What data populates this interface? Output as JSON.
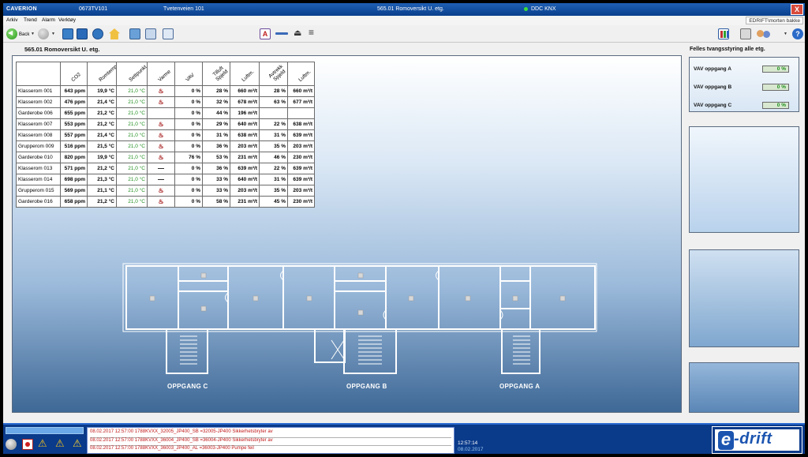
{
  "titlebar": {
    "brand": "CAVERION",
    "project": "0673TV101",
    "address": "Tvetenveien 101",
    "view_title": "565.01 Romoversikt U. etg.",
    "connection": "DDC KNX",
    "close": "X"
  },
  "menu": [
    "Arkiv",
    "Trend",
    "Alarm",
    "Verktøy"
  ],
  "user": "EDRIFT\\morten bakke",
  "toolbar": {
    "back_label": "Back",
    "help_label": "?"
  },
  "main": {
    "title": "565.01 Romoversikt U. etg.",
    "table": {
      "headers": [
        "",
        "CO2",
        "Romtemp",
        "Settpunkt",
        "Varme",
        "VAV",
        "Tilluft Spjeld",
        "Luftm.",
        "Avtrekk Spjeld",
        "Luftm."
      ],
      "rows": [
        {
          "room": "Klasserom 001",
          "co2": "643 ppm",
          "temp": "19,9 °C",
          "set": "21,0 °C",
          "heat": true,
          "vav": "0 %",
          "sup_damper": "28 %",
          "sup_flow": "660 m³/t",
          "ext_damper": "28 %",
          "ext_flow": "660 m³/t"
        },
        {
          "room": "Klasserom 002",
          "co2": "476 ppm",
          "temp": "21,4 °C",
          "set": "21,0 °C",
          "heat": true,
          "vav": "0 %",
          "sup_damper": "32 %",
          "sup_flow": "678 m³/t",
          "ext_damper": "63 %",
          "ext_flow": "677 m³/t"
        },
        {
          "room": "Garderobe 006",
          "co2": "655 ppm",
          "temp": "21,2 °C",
          "set": "21,0 °C",
          "heat": null,
          "vav": "0 %",
          "sup_damper": "44 %",
          "sup_flow": "196 m³/t",
          "ext_damper": "",
          "ext_flow": ""
        },
        {
          "room": "Klasserom 007",
          "co2": "553 ppm",
          "temp": "21,2 °C",
          "set": "21,0 °C",
          "heat": true,
          "vav": "0 %",
          "sup_damper": "29 %",
          "sup_flow": "640 m³/t",
          "ext_damper": "22 %",
          "ext_flow": "638 m³/t"
        },
        {
          "room": "Klasserom 008",
          "co2": "557 ppm",
          "temp": "21,4 °C",
          "set": "21,0 °C",
          "heat": true,
          "vav": "0 %",
          "sup_damper": "31 %",
          "sup_flow": "638 m³/t",
          "ext_damper": "31 %",
          "ext_flow": "639 m³/t"
        },
        {
          "room": "Grupperom 009",
          "co2": "516 ppm",
          "temp": "21,5 °C",
          "set": "21,0 °C",
          "heat": true,
          "vav": "0 %",
          "sup_damper": "36 %",
          "sup_flow": "203 m³/t",
          "ext_damper": "35 %",
          "ext_flow": "203 m³/t"
        },
        {
          "room": "Garderobe 010",
          "co2": "820 ppm",
          "temp": "19,9 °C",
          "set": "21,0 °C",
          "heat": true,
          "vav": "76 %",
          "sup_damper": "53 %",
          "sup_flow": "231 m³/t",
          "ext_damper": "46 %",
          "ext_flow": "230 m³/t"
        },
        {
          "room": "Klasserom 013",
          "co2": "571 ppm",
          "temp": "21,2 °C",
          "set": "21,0 °C",
          "heat": false,
          "vav": "0 %",
          "sup_damper": "36 %",
          "sup_flow": "639 m³/t",
          "ext_damper": "22 %",
          "ext_flow": "639 m³/t"
        },
        {
          "room": "Klasserom 014",
          "co2": "698 ppm",
          "temp": "21,3 °C",
          "set": "21,0 °C",
          "heat": false,
          "vav": "0 %",
          "sup_damper": "33 %",
          "sup_flow": "640 m³/t",
          "ext_damper": "31 %",
          "ext_flow": "639 m³/t"
        },
        {
          "room": "Grupperom 015",
          "co2": "569 ppm",
          "temp": "21,1 °C",
          "set": "21,0 °C",
          "heat": true,
          "vav": "0 %",
          "sup_damper": "33 %",
          "sup_flow": "203 m³/t",
          "ext_damper": "35 %",
          "ext_flow": "203 m³/t"
        },
        {
          "room": "Garderobe 016",
          "co2": "658 ppm",
          "temp": "21,2 °C",
          "set": "21,0 °C",
          "heat": true,
          "vav": "0 %",
          "sup_damper": "58 %",
          "sup_flow": "231 m³/t",
          "ext_damper": "45 %",
          "ext_flow": "230 m³/t"
        }
      ]
    },
    "floorplan": {
      "labels": [
        "OPPGANG C",
        "OPPGANG B",
        "OPPGANG A"
      ]
    }
  },
  "right": {
    "header": "Felles tvangsstyring alle etg.",
    "vav": [
      {
        "label": "VAV oppgang A",
        "value": "0 %"
      },
      {
        "label": "VAV oppgang B",
        "value": "0 %"
      },
      {
        "label": "VAV oppgang C",
        "value": "0 %"
      }
    ]
  },
  "status": {
    "alarms": [
      "08.02.2017 12:57:00   1788KVXX_32005_JP400_SB =32005-JP400 Sikkerhetsbryter av",
      "08.02.2017 12:57:00   1788KVXX_36004_JP400_SB =36004-JP400 Sikkerhetsbryter av",
      "08.02.2017 12:57:00   1788KVXX_36003_JP400_AL =36003-JP400 Pumpe feil"
    ],
    "time": "12:57:14",
    "date": "08.02.2017",
    "logo_e": "e",
    "logo_text": "-drift"
  }
}
